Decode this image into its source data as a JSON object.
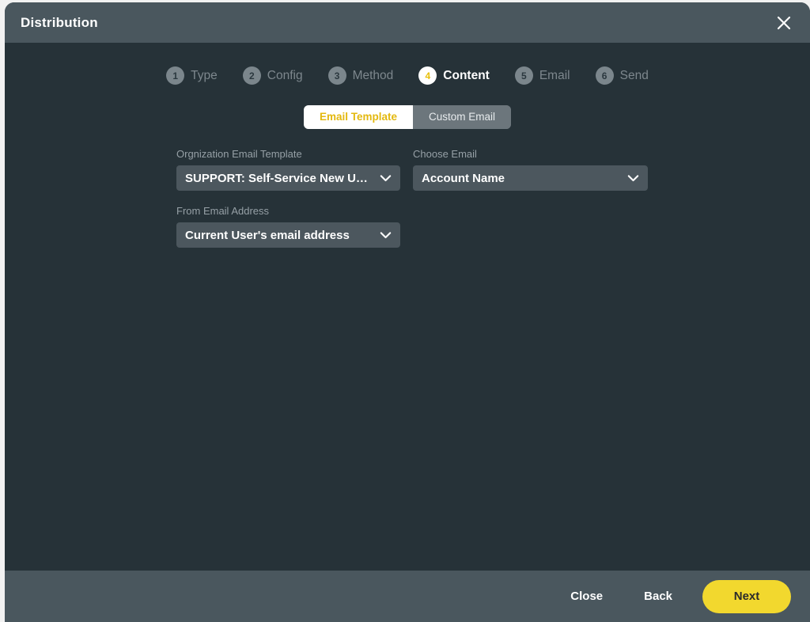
{
  "window": {
    "title": "Distribution",
    "close_icon": "close-icon"
  },
  "stepper": {
    "steps": [
      {
        "number": "1",
        "label": "Type",
        "active": false
      },
      {
        "number": "2",
        "label": "Config",
        "active": false
      },
      {
        "number": "3",
        "label": "Method",
        "active": false
      },
      {
        "number": "4",
        "label": "Content",
        "active": true
      },
      {
        "number": "5",
        "label": "Email",
        "active": false
      },
      {
        "number": "6",
        "label": "Send",
        "active": false
      }
    ]
  },
  "tabs": {
    "items": [
      {
        "label": "Email Template",
        "active": true
      },
      {
        "label": "Custom Email",
        "active": false
      }
    ]
  },
  "form": {
    "org_template": {
      "label": "Orgnization Email Template",
      "value": "SUPPORT: Self-Service New Use...",
      "chevron_icon": "chevron-down-icon"
    },
    "choose_email": {
      "label": "Choose Email",
      "value": "Account Name",
      "chevron_icon": "chevron-down-icon"
    },
    "from_email": {
      "label": "From Email Address",
      "value": "Current User's email address",
      "chevron_icon": "chevron-down-icon"
    }
  },
  "footer": {
    "close_label": "Close",
    "back_label": "Back",
    "next_label": "Next"
  },
  "colors": {
    "header_bg": "#4a575e",
    "body_bg": "#263238",
    "footer_bg": "#4a575e",
    "accent_yellow": "#f2d82e",
    "tab_accent": "#e3b80e",
    "field_bg": "#4c575e",
    "muted_text": "#96a0a6",
    "step_inactive": "#7b868c"
  }
}
